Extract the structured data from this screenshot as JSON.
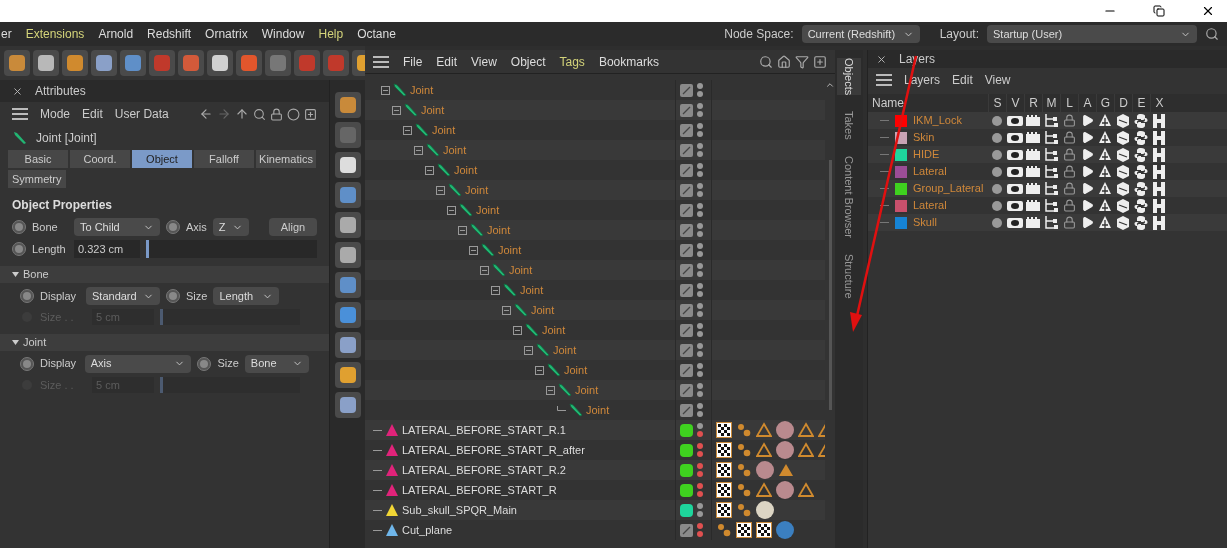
{
  "menu": [
    {
      "label": "er",
      "highlighted": false
    },
    {
      "label": "Extensions",
      "highlighted": true
    },
    {
      "label": "Arnold",
      "highlighted": false
    },
    {
      "label": "Redshift",
      "highlighted": false
    },
    {
      "label": "Ornatrix",
      "highlighted": false
    },
    {
      "label": "Window",
      "highlighted": false
    },
    {
      "label": "Help",
      "highlighted": true
    },
    {
      "label": "Octane",
      "highlighted": false
    }
  ],
  "node_space": {
    "label": "Node Space:",
    "value": "Current (Redshift)"
  },
  "layout": {
    "label": "Layout:",
    "value": "Startup (User)"
  },
  "attributes": {
    "title": "Attributes",
    "menu": [
      "Mode",
      "Edit",
      "User Data"
    ],
    "object_title": "Joint [Joint]",
    "tabs": [
      {
        "label": "Basic",
        "selected": false
      },
      {
        "label": "Coord.",
        "selected": false
      },
      {
        "label": "Object",
        "selected": true
      },
      {
        "label": "Falloff",
        "selected": false
      },
      {
        "label": "Kinematics",
        "selected": false
      },
      {
        "label": "Symmetry",
        "selected": false
      }
    ],
    "section": "Object Properties",
    "bone": {
      "label": "Bone",
      "value": "To Child",
      "animated": false
    },
    "axis": {
      "label": "Axis",
      "value": "Z",
      "animated": false
    },
    "align": "Align",
    "length": {
      "label": "Length",
      "value": "0.323 cm",
      "level": 0.01,
      "animated": false
    },
    "groups": [
      {
        "title": "Bone",
        "expanded": true,
        "display": {
          "label": "Display",
          "value": "Standard",
          "animated": false
        },
        "size_mode": {
          "label": "Size",
          "value": "Length",
          "animated": false
        },
        "size": {
          "label": "Size . .",
          "value": "5 cm",
          "disabled": true,
          "level": 0
        }
      },
      {
        "title": "Joint",
        "expanded": true,
        "display": {
          "label": "Display",
          "value": "Axis",
          "animated": false
        },
        "size_mode": {
          "label": "Size",
          "value": "Bone",
          "animated": false
        },
        "size": {
          "label": "Size . .",
          "value": "5 cm",
          "disabled": true,
          "level": 0
        }
      }
    ]
  },
  "objects": {
    "menu": [
      {
        "label": "File",
        "highlighted": false
      },
      {
        "label": "Edit",
        "highlighted": false
      },
      {
        "label": "View",
        "highlighted": false
      },
      {
        "label": "Object",
        "highlighted": false
      },
      {
        "label": "Tags",
        "highlighted": true
      },
      {
        "label": "Bookmarks",
        "highlighted": false
      }
    ],
    "tree": [
      {
        "name": "Joint",
        "kind": "joint",
        "expanded": true,
        "editor_hidden": false,
        "render_hidden": false,
        "children": [
          {
            "name": "Joint",
            "kind": "joint",
            "expanded": true,
            "editor_hidden": false,
            "render_hidden": false,
            "children": [
              {
                "name": "Joint",
                "kind": "joint",
                "expanded": true,
                "editor_hidden": false,
                "render_hidden": false,
                "children": [
                  {
                    "name": "Joint",
                    "kind": "joint",
                    "expanded": true,
                    "editor_hidden": false,
                    "render_hidden": false,
                    "children": [
                      {
                        "name": "Joint",
                        "kind": "joint",
                        "expanded": true,
                        "editor_hidden": false,
                        "render_hidden": false,
                        "children": [
                          {
                            "name": "Joint",
                            "kind": "joint",
                            "expanded": true,
                            "editor_hidden": false,
                            "render_hidden": false,
                            "children": [
                              {
                                "name": "Joint",
                                "kind": "joint",
                                "expanded": true,
                                "editor_hidden": false,
                                "render_hidden": false,
                                "children": [
                                  {
                                    "name": "Joint",
                                    "kind": "joint",
                                    "expanded": true,
                                    "editor_hidden": false,
                                    "render_hidden": false,
                                    "children": [
                                      {
                                        "name": "Joint",
                                        "kind": "joint",
                                        "expanded": true,
                                        "editor_hidden": false,
                                        "render_hidden": false,
                                        "children": [
                                          {
                                            "name": "Joint",
                                            "kind": "joint",
                                            "expanded": true,
                                            "editor_hidden": false,
                                            "render_hidden": false,
                                            "children": [
                                              {
                                                "name": "Joint",
                                                "kind": "joint",
                                                "expanded": true,
                                                "editor_hidden": false,
                                                "render_hidden": false,
                                                "children": [
                                                  {
                                                    "name": "Joint",
                                                    "kind": "joint",
                                                    "expanded": true,
                                                    "editor_hidden": false,
                                                    "render_hidden": false,
                                                    "children": [
                                                      {
                                                        "name": "Joint",
                                                        "kind": "joint",
                                                        "expanded": true,
                                                        "editor_hidden": false,
                                                        "render_hidden": false,
                                                        "children": [
                                                          {
                                                            "name": "Joint",
                                                            "kind": "joint",
                                                            "expanded": true,
                                                            "editor_hidden": false,
                                                            "render_hidden": false,
                                                            "children": [
                                                              {
                                                                "name": "Joint",
                                                                "kind": "joint",
                                                                "expanded": true,
                                                                "editor_hidden": false,
                                                                "render_hidden": false,
                                                                "children": [
                                                                  {
                                                                    "name": "Joint",
                                                                    "kind": "joint",
                                                                    "expanded": true,
                                                                    "editor_hidden": false,
                                                                    "render_hidden": false,
                                                                    "children": [
                                                                      {
                                                                        "name": "Joint",
                                                                        "kind": "joint",
                                                                        "editor_hidden": false,
                                                                        "render_hidden": false
                                                                      }
                                                                    ]
                                                                  }
                                                                ]
                                                              }
                                                            ]
                                                          }
                                                        ]
                                                      }
                                                    ]
                                                  }
                                                ]
                                              }
                                            ]
                                          }
                                        ]
                                      }
                                    ]
                                  }
                                ]
                              }
                            ]
                          }
                        ]
                      }
                    ]
                  }
                ]
              }
            ]
          }
        ]
      },
      {
        "name": "LATERAL_BEFORE_START_R.1",
        "kind": "polygon",
        "icon": {
          "color": "#e0237a"
        },
        "layer": {
          "color": "#3fd11f"
        },
        "editor_hidden": false,
        "render_hidden": true,
        "tags": [
          {
            "kind": "checker"
          },
          {
            "kind": "dots"
          },
          {
            "kind": "triangle"
          },
          {
            "kind": "sphere",
            "color": "#b98a8e"
          },
          {
            "kind": "triangle"
          },
          {
            "kind": "triangle"
          }
        ]
      },
      {
        "name": "LATERAL_BEFORE_START_R_after",
        "kind": "polygon",
        "icon": {
          "color": "#e0237a"
        },
        "layer": {
          "color": "#3fd11f"
        },
        "editor_hidden": true,
        "render_hidden": true,
        "tags": [
          {
            "kind": "checker"
          },
          {
            "kind": "dots"
          },
          {
            "kind": "triangle"
          },
          {
            "kind": "sphere",
            "color": "#b98a8e"
          },
          {
            "kind": "triangle"
          },
          {
            "kind": "triangle"
          }
        ]
      },
      {
        "name": "LATERAL_BEFORE_START_R.2",
        "kind": "polygon",
        "icon": {
          "color": "#e0237a"
        },
        "layer": {
          "color": "#3fd11f"
        },
        "editor_hidden": true,
        "render_hidden": true,
        "tags": [
          {
            "kind": "checker"
          },
          {
            "kind": "dots"
          },
          {
            "kind": "sphere",
            "color": "#b98a8e"
          },
          {
            "kind": "solid_triangle"
          }
        ]
      },
      {
        "name": "LATERAL_BEFORE_START_R",
        "kind": "polygon",
        "icon": {
          "color": "#e0237a"
        },
        "layer": {
          "color": "#3fd11f"
        },
        "editor_hidden": true,
        "render_hidden": true,
        "tags": [
          {
            "kind": "checker"
          },
          {
            "kind": "dots"
          },
          {
            "kind": "triangle"
          },
          {
            "kind": "sphere",
            "color": "#b98a8e"
          },
          {
            "kind": "triangle"
          }
        ]
      },
      {
        "name": "Sub_skull_SPQR_Main",
        "kind": "polygon",
        "icon": {
          "color": "#f1d635"
        },
        "layer": {
          "color": "#1ed69c"
        },
        "editor_hidden": false,
        "render_hidden": false,
        "tags": [
          {
            "kind": "checker"
          },
          {
            "kind": "dots"
          },
          {
            "kind": "sphere",
            "color": "#dcd5c4"
          }
        ]
      },
      {
        "name": "Cut_plane",
        "kind": "polygon",
        "icon": {
          "color": "#6fb6ea"
        },
        "editor_hidden": true,
        "render_hidden": true,
        "tags": [
          {
            "kind": "dots"
          },
          {
            "kind": "checker"
          },
          {
            "kind": "checker"
          },
          {
            "kind": "sphere",
            "color": "#3b7fc0"
          }
        ]
      }
    ]
  },
  "side_tabs": [
    {
      "label": "Objects",
      "selected": true
    },
    {
      "label": "Takes",
      "selected": false
    },
    {
      "label": "Content Browser",
      "selected": false
    },
    {
      "label": "Structure",
      "selected": false
    }
  ],
  "layers": {
    "title": "Layers",
    "menu": [
      "Layers",
      "Edit",
      "View"
    ],
    "name_column": "Name",
    "columns": [
      "S",
      "V",
      "R",
      "M",
      "L",
      "A",
      "G",
      "D",
      "E",
      "X"
    ],
    "items": [
      {
        "name": "IKM_Lock",
        "color": "#ff0000"
      },
      {
        "name": "Skin",
        "color": "#c9a3b5"
      },
      {
        "name": "HIDE",
        "color": "#1ed69c"
      },
      {
        "name": "Lateral",
        "color": "#9b4d96"
      },
      {
        "name": "Group_Lateral",
        "color": "#3fd11f"
      },
      {
        "name": "Lateral",
        "color": "#c9506c"
      },
      {
        "name": "Skull",
        "color": "#1683d4"
      }
    ]
  }
}
